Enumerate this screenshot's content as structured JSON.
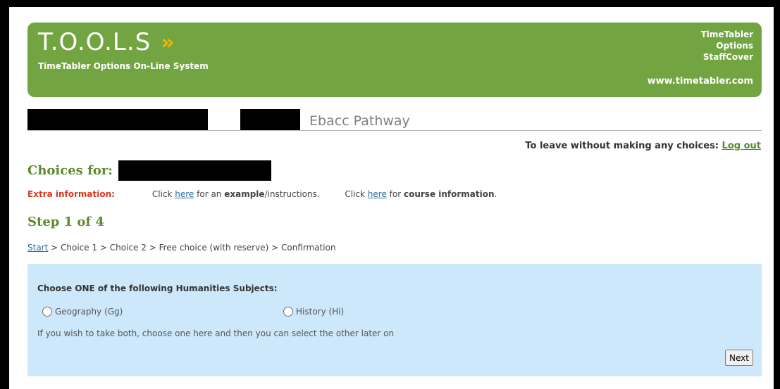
{
  "banner": {
    "brand": "T.O.O.L.S",
    "brand_arrows": "»",
    "tagline": "TimeTabler Options On-Line System",
    "links": [
      "TimeTabler",
      "Options",
      "StaffCover"
    ],
    "url": "www.timetabler.com",
    "colors": {
      "background": "#72a542",
      "accent": "#f4b400"
    }
  },
  "pathway": {
    "title": "Ebacc Pathway"
  },
  "leave": {
    "text": "To leave without making any choices:",
    "link": "Log out"
  },
  "choices_for": {
    "label": "Choices for:"
  },
  "extra": {
    "label": "Extra information:",
    "item1": {
      "prefix": "Click",
      "link": "here",
      "middle": "for an",
      "bold": "example",
      "suffix": "/instructions."
    },
    "item2": {
      "prefix": "Click",
      "link": "here",
      "middle": "for",
      "bold": "course information",
      "suffix": "."
    }
  },
  "step": {
    "title": "Step 1 of 4"
  },
  "breadcrumb": {
    "start": "Start",
    "rest": "> Choice 1 > Choice 2 > Free choice (with reserve) > Confirmation"
  },
  "panel": {
    "heading": "Choose ONE of the following Humanities Subjects:",
    "options": [
      "Geography (Gg)",
      "History (Hi)"
    ],
    "note": "If you wish to take both, choose one here and then you can select the other later on",
    "next_label": "Next",
    "background": "#cce8fa"
  }
}
